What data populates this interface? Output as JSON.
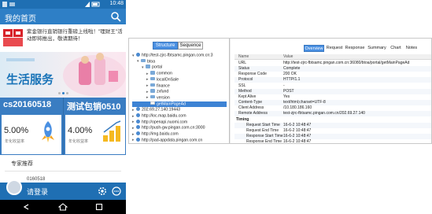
{
  "phone": {
    "statusbar": {
      "time": "10:48"
    },
    "header": {
      "title": "我的首页"
    },
    "notice": {
      "text": "紫金银行直销银行重磅上线啦！\"理财王\"活动即将推出，敬请期待！"
    },
    "banner": {
      "text": "生活服务",
      "slides": 3,
      "active": 1
    },
    "products": [
      {
        "name": "cs20160518",
        "rate": "5.00%",
        "rate_label": "年化收益率"
      },
      {
        "name": "测试包销0510",
        "rate": "4.00%",
        "rate_label": "年化收益率"
      }
    ],
    "expert": {
      "heading": "专家推荐",
      "item": "0160518"
    },
    "login_bar": {
      "label": "请登录"
    },
    "icons": [
      "search-icon",
      "settings-icon",
      "chat-icon",
      "back-icon",
      "home-icon",
      "recent-apps-icon"
    ]
  },
  "desktop": {
    "view_tabs": [
      "Structure",
      "Sequence"
    ],
    "active_view": 0,
    "tree": [
      {
        "level": 0,
        "kind": "globe",
        "open": true,
        "label": "http://test-zjrc-fbtsamc.pingan.com.cn:3"
      },
      {
        "level": 1,
        "kind": "folder",
        "open": true,
        "label": "btoa"
      },
      {
        "level": 2,
        "kind": "folder",
        "open": true,
        "label": "portal"
      },
      {
        "level": 3,
        "kind": "folder",
        "open": false,
        "label": "common"
      },
      {
        "level": 3,
        "kind": "folder",
        "open": false,
        "label": "localOnSale"
      },
      {
        "level": 3,
        "kind": "folder",
        "open": false,
        "label": "finance"
      },
      {
        "level": 3,
        "kind": "folder",
        "open": false,
        "label": "zxfund"
      },
      {
        "level": 3,
        "kind": "folder",
        "open": false,
        "label": "version"
      },
      {
        "level": 3,
        "kind": "file",
        "open": false,
        "label": "getMainPageAd",
        "selected": true
      },
      {
        "level": 0,
        "kind": "globe",
        "open": false,
        "label": "202.69.27.140:19443"
      },
      {
        "level": 0,
        "kind": "globe",
        "open": false,
        "label": "http://loc.map.baidu.com"
      },
      {
        "level": 0,
        "kind": "globe",
        "open": false,
        "label": "http://openapi.nuomi.com"
      },
      {
        "level": 0,
        "kind": "globe",
        "open": false,
        "label": "http://push-gw.pingan.com.cn:3000"
      },
      {
        "level": 0,
        "kind": "globe",
        "open": false,
        "label": "http://img.baidu.com"
      },
      {
        "level": 0,
        "kind": "globe",
        "open": false,
        "label": "http://pad-appdata.pingan.com.cn"
      }
    ],
    "tabs": [
      "Overview",
      "Request",
      "Response",
      "Summary",
      "Chart",
      "Notes"
    ],
    "active_tab": 0,
    "columns": [
      "Name",
      "Value"
    ],
    "rows": [
      {
        "name": "URL",
        "value": "http://test-zjrc-fbtsamc.pingan.com.cn:36080/btoa/portal/getMainPageAd"
      },
      {
        "name": "Status",
        "value": "Complete"
      },
      {
        "name": "Response Code",
        "value": "200 OK"
      },
      {
        "name": "Protocol",
        "value": "HTTP/1.1"
      },
      {
        "name": "SSL",
        "value": "-"
      },
      {
        "name": "Method",
        "value": "POST"
      },
      {
        "name": "Kept Alive",
        "value": "Yes"
      },
      {
        "name": "Content-Type",
        "value": "text/html;charset=UTF-8"
      },
      {
        "name": "Client Address",
        "value": "/10.180.186.160"
      },
      {
        "name": "Remote Address",
        "value": "test-zjrc-fbtsamc.pingan.com.cn/202.69.27.140"
      },
      {
        "name": "Timing",
        "value": "",
        "section": true
      },
      {
        "name": "Request Start Time",
        "value": "16-6-2 10:48:47"
      },
      {
        "name": "Request End Time",
        "value": "16-6-2 10:48:47"
      },
      {
        "name": "Response Start Time",
        "value": "16-6-2 10:48:47"
      },
      {
        "name": "Response End Time",
        "value": "16-6-2 10:48:47"
      }
    ]
  }
}
